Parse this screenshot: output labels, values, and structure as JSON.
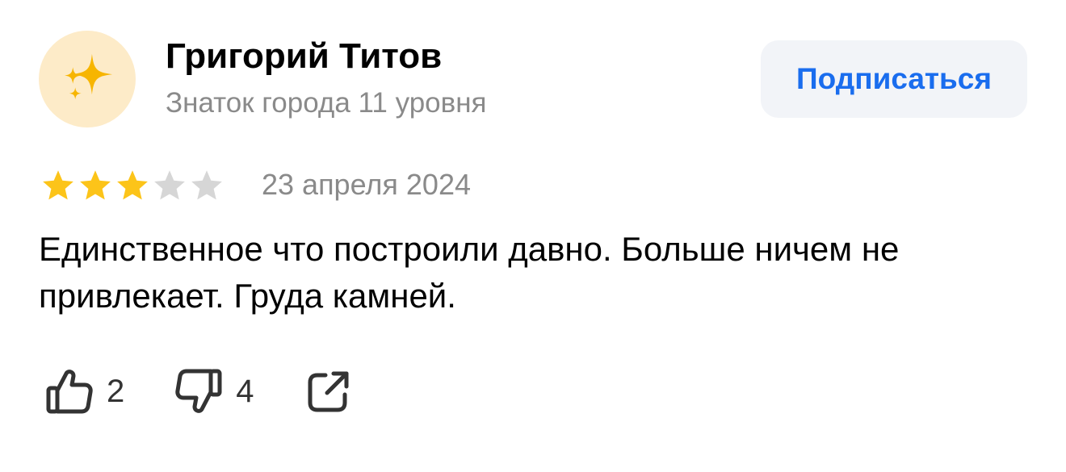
{
  "author": {
    "name": "Григорий Титов",
    "level": "Знаток города 11 уровня",
    "avatar_icon": "sparkles-icon",
    "avatar_background": "#fdebc8"
  },
  "subscribe": {
    "label": "Подписаться",
    "color": "#1a6dee"
  },
  "review": {
    "rating": 3,
    "max_rating": 5,
    "date": "23 апреля 2024",
    "text": "Единственное что построили давно. Больше ничем не привлекает. Груда камней."
  },
  "actions": {
    "likes": "2",
    "dislikes": "4",
    "like_icon": "thumbs-up-icon",
    "dislike_icon": "thumbs-down-icon",
    "share_icon": "share-icon"
  },
  "colors": {
    "star_filled": "#fcc419",
    "star_empty": "#d6d6d6",
    "secondary_text": "#8a8a8a"
  }
}
